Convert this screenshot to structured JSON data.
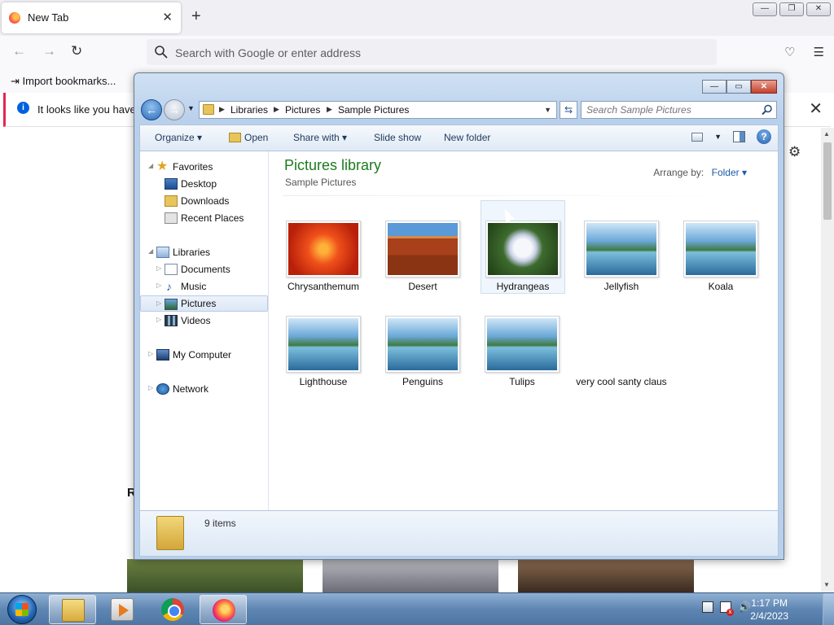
{
  "browser": {
    "tab_title": "New Tab",
    "tab_close": "✕",
    "new_tab": "+",
    "url_placeholder": "Search with Google or enter address",
    "bookmark_import": "Import bookmarks...",
    "notice_text": "It looks like you haven't",
    "notice_close": "✕",
    "section_heading": "R",
    "window_controls": [
      "—",
      "❐",
      "✕"
    ]
  },
  "explorer": {
    "caption_buttons": [
      "—",
      "▭",
      "✕"
    ],
    "breadcrumb": [
      "Libraries",
      "Pictures",
      "Sample Pictures"
    ],
    "search_placeholder": "Search Sample Pictures",
    "toolbar": {
      "organize": "Organize",
      "open": "Open",
      "share_with": "Share with",
      "slide_show": "Slide show",
      "new_folder": "New folder"
    },
    "nav": {
      "favorites": "Favorites",
      "desktop": "Desktop",
      "downloads": "Downloads",
      "recent_places": "Recent Places",
      "libraries": "Libraries",
      "documents": "Documents",
      "music": "Music",
      "pictures": "Pictures",
      "videos": "Videos",
      "my_computer": "My Computer",
      "network": "Network"
    },
    "library_title": "Pictures library",
    "library_subtitle": "Sample Pictures",
    "arrange_by_label": "Arrange by:",
    "arrange_by_value": "Folder",
    "items": [
      {
        "name": "Chrysanthemum",
        "thumb": "chrysanthemum"
      },
      {
        "name": "Desert",
        "thumb": "desert"
      },
      {
        "name": "Hydrangeas",
        "thumb": "hydrangeas"
      },
      {
        "name": "Jellyfish",
        "thumb": "default-landscape"
      },
      {
        "name": "Koala",
        "thumb": "default-landscape"
      },
      {
        "name": "Lighthouse",
        "thumb": "default-landscape"
      },
      {
        "name": "Penguins",
        "thumb": "default-landscape"
      },
      {
        "name": "Tulips",
        "thumb": "default-landscape"
      },
      {
        "name": "very cool santy claus",
        "thumb": "none"
      }
    ],
    "item_count": "9 items"
  },
  "taskbar": {
    "time": "1:17 PM",
    "date": "2/4/2023",
    "apps": [
      "windows-explorer",
      "windows-media-player",
      "google-chrome",
      "firefox"
    ]
  }
}
